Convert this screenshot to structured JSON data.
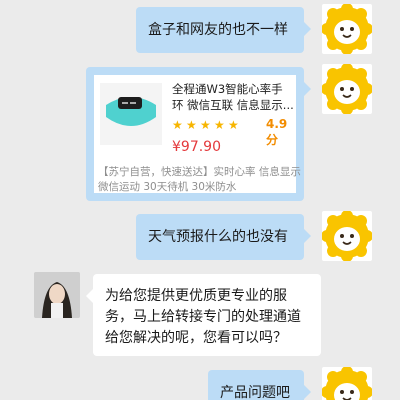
{
  "messages": [
    {
      "from": "user",
      "text": "盒子和网友的也不一样"
    },
    {
      "from": "user",
      "type": "product_card",
      "product": {
        "title": "全程通W3智能心率手环 微信互联 信息显示...",
        "rating_stars": 5,
        "rating_score": "4.9分",
        "price": "¥97.90",
        "description": "【苏宁自营，快速送达】实时心率 信息显示 微信运动 30天待机 30米防水"
      }
    },
    {
      "from": "user",
      "text": "天气预报什么的也没有"
    },
    {
      "from": "agent",
      "text": "为给您提供更优质更专业的服务，马上给转接专门的处理通道给您解决的呢，您看可以吗？"
    },
    {
      "from": "user",
      "text": "产品问题吧"
    }
  ],
  "colors": {
    "background": "#ebebeb",
    "user_bubble": "#bcdcf6",
    "agent_bubble": "#ffffff",
    "price": "#e4393c",
    "stars": "#f7b500",
    "score": "#f28c00",
    "logo_yellow": "#f9c400"
  },
  "icons": {
    "user_avatar": "suning-lion-logo-icon",
    "agent_avatar": "agent-photo-avatar",
    "rating": "star-icon"
  }
}
